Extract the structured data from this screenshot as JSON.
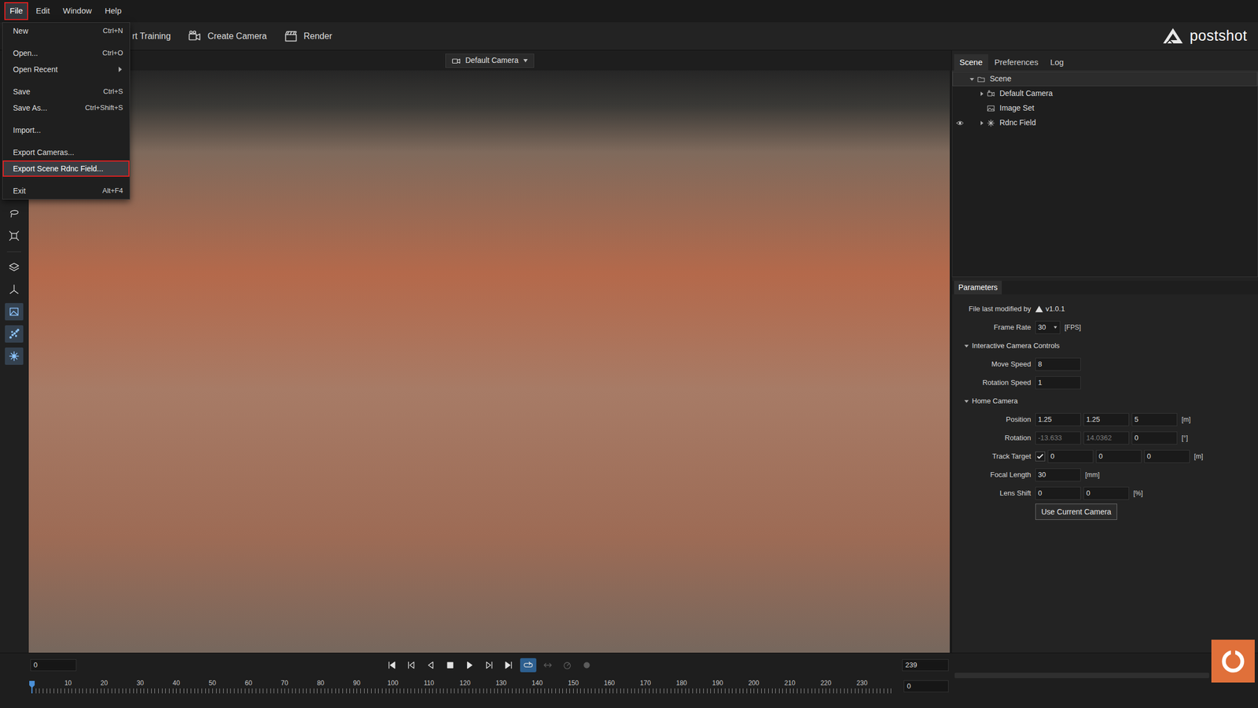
{
  "menubar": [
    {
      "label": "File",
      "selected": true,
      "annotated": true
    },
    {
      "label": "Edit",
      "selected": false,
      "annotated": false
    },
    {
      "label": "Window",
      "selected": false,
      "annotated": false
    },
    {
      "label": "Help",
      "selected": false,
      "annotated": false
    }
  ],
  "file_menu": {
    "entries": [
      {
        "kind": "item",
        "label": "New",
        "shortcut": "Ctrl+N",
        "submenu": false,
        "highlighted": false,
        "annotated": false
      },
      {
        "kind": "separator"
      },
      {
        "kind": "item",
        "label": "Open...",
        "shortcut": "Ctrl+O",
        "submenu": false,
        "highlighted": false,
        "annotated": false
      },
      {
        "kind": "item",
        "label": "Open Recent",
        "submenu": true,
        "highlighted": false,
        "annotated": false
      },
      {
        "kind": "separator"
      },
      {
        "kind": "item",
        "label": "Save",
        "shortcut": "Ctrl+S",
        "submenu": false,
        "highlighted": false,
        "annotated": false
      },
      {
        "kind": "item",
        "label": "Save As...",
        "shortcut": "Ctrl+Shift+S",
        "submenu": false,
        "highlighted": false,
        "annotated": false
      },
      {
        "kind": "separator"
      },
      {
        "kind": "item",
        "label": "Import...",
        "submenu": false,
        "highlighted": false,
        "annotated": false
      },
      {
        "kind": "separator"
      },
      {
        "kind": "item",
        "label": "Export Cameras...",
        "submenu": false,
        "highlighted": false,
        "annotated": false
      },
      {
        "kind": "item",
        "label": "Export Scene Rdnc Field...",
        "submenu": false,
        "highlighted": true,
        "annotated": true
      },
      {
        "kind": "separator"
      },
      {
        "kind": "item",
        "label": "Exit",
        "shortcut": "Alt+F4",
        "submenu": false,
        "highlighted": false,
        "annotated": false
      }
    ]
  },
  "toolbar": {
    "buttons": [
      {
        "kind": "training",
        "label": "rt Training"
      },
      {
        "kind": "camera",
        "label": "Create Camera"
      },
      {
        "kind": "render",
        "label": "Render"
      }
    ],
    "logo": "postshot"
  },
  "viewport": {
    "camera": "Default Camera"
  },
  "tools": [
    {
      "kind": "lasso",
      "active": false
    },
    {
      "kind": "box_select",
      "active": false
    },
    {
      "kind": "separator"
    },
    {
      "kind": "layers",
      "active": false
    },
    {
      "kind": "axes",
      "active": false
    },
    {
      "kind": "frame",
      "active": true
    },
    {
      "kind": "points",
      "active": true
    },
    {
      "kind": "splat",
      "active": true
    }
  ],
  "right_panel": {
    "tabs": [
      {
        "label": "Scene",
        "selected": true
      },
      {
        "label": "Preferences",
        "selected": false
      },
      {
        "label": "Log",
        "selected": false
      }
    ],
    "tree": [
      {
        "kind": "scene",
        "label": "Scene",
        "depth": 0,
        "expandable": true,
        "expanded": true,
        "selected": true,
        "visibility": false
      },
      {
        "kind": "camera",
        "label": "Default Camera",
        "depth": 1,
        "expandable": true,
        "expanded": false,
        "selected": false,
        "visibility": false
      },
      {
        "kind": "images",
        "label": "Image Set",
        "depth": 1,
        "expandable": false,
        "expanded": false,
        "selected": false,
        "visibility": false
      },
      {
        "kind": "field",
        "label": "Rdnc Field",
        "depth": 1,
        "expandable": true,
        "expanded": false,
        "selected": false,
        "visibility": true
      }
    ]
  },
  "parameters": {
    "title": "Parameters",
    "rows": [
      {
        "kind": "info",
        "label": "File last modified by",
        "value": "v1.0.1"
      },
      {
        "kind": "select",
        "label": "Frame Rate",
        "value": "30",
        "unit": "[FPS]"
      },
      {
        "kind": "section",
        "label": "Interactive Camera Controls",
        "expanded": true
      },
      {
        "kind": "field",
        "label": "Move Speed",
        "values": [
          {
            "text": "8",
            "disabled": false
          }
        ]
      },
      {
        "kind": "field",
        "label": "Rotation Speed",
        "values": [
          {
            "text": "1",
            "disabled": false
          }
        ]
      },
      {
        "kind": "section",
        "label": "Home Camera",
        "expanded": true
      },
      {
        "kind": "field",
        "label": "Position",
        "values": [
          {
            "text": "1.25",
            "disabled": false
          },
          {
            "text": "1.25",
            "disabled": false
          },
          {
            "text": "5",
            "disabled": false
          }
        ],
        "unit": "[m]"
      },
      {
        "kind": "field",
        "label": "Rotation",
        "values": [
          {
            "text": "-13.633",
            "disabled": true
          },
          {
            "text": "14.0362",
            "disabled": true
          },
          {
            "text": "0",
            "disabled": false
          }
        ],
        "unit": "[°]"
      },
      {
        "kind": "checkfield",
        "label": "Track Target",
        "checked": true,
        "values": [
          {
            "text": "0",
            "disabled": false
          },
          {
            "text": "0",
            "disabled": false
          },
          {
            "text": "0",
            "disabled": false
          }
        ],
        "unit": "[m]"
      },
      {
        "kind": "field",
        "label": "Focal Length",
        "values": [
          {
            "text": "30",
            "disabled": false
          }
        ],
        "unit": "[mm]"
      },
      {
        "kind": "field",
        "label": "Lens Shift",
        "values": [
          {
            "text": "0",
            "disabled": false
          },
          {
            "text": "0",
            "disabled": false
          }
        ],
        "unit": "[%]"
      },
      {
        "kind": "button",
        "label": "Use Current Camera"
      }
    ]
  },
  "timeline": {
    "current": "0",
    "end": "239",
    "frame": "0",
    "labels": [
      "10",
      "20",
      "30",
      "40",
      "50",
      "60",
      "70",
      "80",
      "90",
      "100",
      "110",
      "120",
      "130",
      "140",
      "150",
      "160",
      "170",
      "180",
      "190",
      "200",
      "210",
      "220",
      "230"
    ],
    "controls": [
      {
        "kind": "first",
        "enabled": true,
        "active": false
      },
      {
        "kind": "prev_key",
        "enabled": true,
        "active": false
      },
      {
        "kind": "prev",
        "enabled": true,
        "active": false
      },
      {
        "kind": "stop",
        "enabled": true,
        "active": false
      },
      {
        "kind": "play",
        "enabled": true,
        "active": false
      },
      {
        "kind": "next_key",
        "enabled": true,
        "active": false
      },
      {
        "kind": "last",
        "enabled": true,
        "active": false
      },
      {
        "kind": "loop",
        "enabled": true,
        "active": true
      },
      {
        "kind": "bounce",
        "enabled": false,
        "active": false
      },
      {
        "kind": "speed",
        "enabled": false,
        "active": false
      },
      {
        "kind": "record",
        "enabled": false,
        "active": false
      }
    ]
  }
}
